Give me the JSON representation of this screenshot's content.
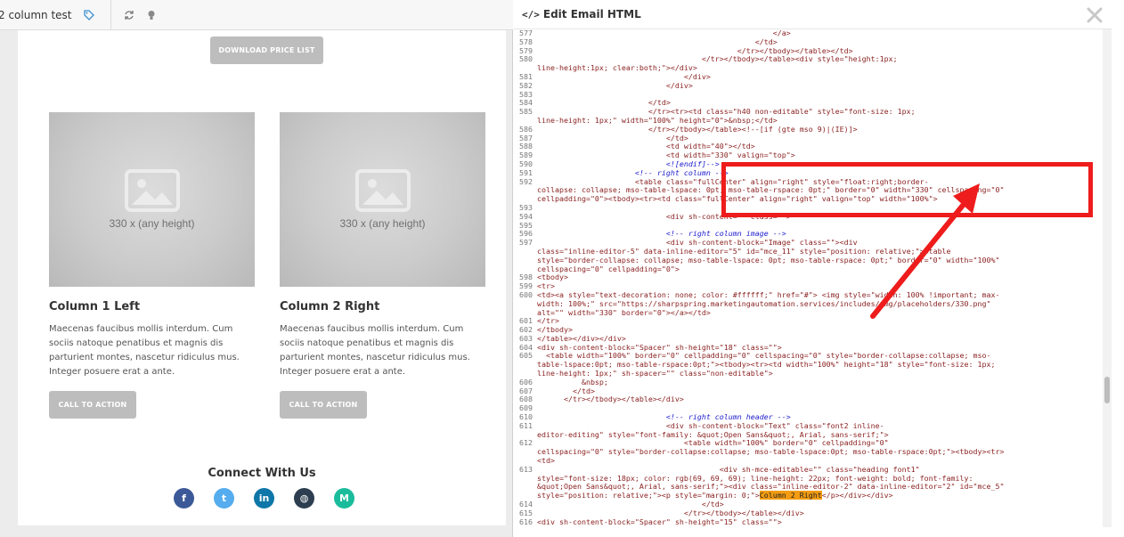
{
  "left_panel": {
    "title": "2 column test",
    "download_button": "DOWNLOAD PRICE LIST",
    "columns": [
      {
        "image_caption": "330 x (any height)",
        "heading": "Column 1 Left",
        "body": "Maecenas faucibus mollis interdum. Cum sociis natoque penatibus et magnis dis parturient montes, nascetur ridiculus mus. Integer posuere erat a ante.",
        "cta": "CALL TO ACTION"
      },
      {
        "image_caption": "330 x (any height)",
        "heading": "Column 2 Right",
        "body": "Maecenas faucibus mollis interdum. Cum sociis natoque penatibus et magnis dis parturient montes, nascetur ridiculus mus. Integer posuere erat a ante.",
        "cta": "CALL TO ACTION"
      }
    ],
    "connect_heading": "Connect With Us",
    "social_icons": [
      {
        "name": "facebook-icon",
        "glyph": "f",
        "color": "#3b5998"
      },
      {
        "name": "twitter-icon",
        "glyph": "t",
        "color": "#55acee"
      },
      {
        "name": "linkedin-icon",
        "glyph": "in",
        "color": "#0e76a8"
      },
      {
        "name": "globe-icon",
        "glyph": "◍",
        "color": "#2c3e50"
      },
      {
        "name": "m-icon",
        "glyph": "M",
        "color": "#1abc9c"
      }
    ]
  },
  "right_panel": {
    "title": "Edit Email HTML",
    "code_lines": [
      {
        "n": "577",
        "t": "                                                     </a>"
      },
      {
        "n": "578",
        "t": "                                                 </td>"
      },
      {
        "n": "579",
        "t": "                                             </tr></tbody></table></td>"
      },
      {
        "n": "580",
        "t": "                                     </tr></tbody></table><div style=\"height:1px;"
      },
      {
        "n": "",
        "t": "line-height:1px; clear:both;\"></div>"
      },
      {
        "n": "581",
        "t": "                                 </div>"
      },
      {
        "n": "582",
        "t": "                             </div>"
      },
      {
        "n": "583",
        "t": ""
      },
      {
        "n": "584",
        "t": "                         </td>"
      },
      {
        "n": "585",
        "t": "                         </tr><tr><td class=\"h40 non-editable\" style=\"font-size: 1px;"
      },
      {
        "n": "",
        "t": "line-height: 1px;\" width=\"100%\" height=\"0\">&nbsp;</td>"
      },
      {
        "n": "586",
        "t": "                         </tr></tbody></table><!--[if (gte mso 9)|(IE)]>"
      },
      {
        "n": "587",
        "t": "                             </td>"
      },
      {
        "n": "588",
        "t": "                             <td width=\"40\"></td>"
      },
      {
        "n": "589",
        "t": "                             <td width=\"330\" valign=\"top\">"
      },
      {
        "n": "590",
        "t": "                             <![endif]-->"
      },
      {
        "n": "591",
        "t": "                      <!-- right column -->"
      },
      {
        "n": "592",
        "t": "                      <table class=\"fullCenter\" align=\"right\" style=\"float:right;border-"
      },
      {
        "n": "",
        "t": "collapse: collapse; mso-table-lspace: 0pt; mso-table-rspace: 0pt;\" border=\"0\" width=\"330\" cellspacing=\"0\""
      },
      {
        "n": "",
        "t": "cellpadding=\"0\"><tbody><tr><td class=\"fullCenter\" align=\"right\" valign=\"top\" width=\"100%\">"
      },
      {
        "n": "593",
        "t": ""
      },
      {
        "n": "594",
        "t": "                             <div sh-content=\"\" class=\"\">"
      },
      {
        "n": "595",
        "t": ""
      },
      {
        "n": "596",
        "t": "                             <!-- right column image -->"
      },
      {
        "n": "597",
        "t": "                             <div sh-content-block=\"Image\" class=\"\"><div"
      },
      {
        "n": "",
        "t": "class=\"inline-editor-5\" data-inline-editor=\"5\" id=\"mce_11\" style=\"position: relative;\"><table"
      },
      {
        "n": "",
        "t": "style=\"border-collapse: collapse; mso-table-lspace: 0pt; mso-table-rspace: 0pt;\" border=\"0\" width=\"100%\""
      },
      {
        "n": "",
        "t": "cellspacing=\"0\" cellpadding=\"0\">"
      },
      {
        "n": "598",
        "t": "<tbody>"
      },
      {
        "n": "599",
        "t": "<tr>"
      },
      {
        "n": "600",
        "t": "<td><a style=\"text-decoration: none; color: #ffffff;\" href=\"#\"> <img style=\"width: 100% !important; max-"
      },
      {
        "n": "",
        "t": "width: 100%;\" src=\"https://sharpspring.marketingautomation.services/includes/img/placeholders/330.png\""
      },
      {
        "n": "",
        "t": "alt=\"\" width=\"330\" border=\"0\"></a></td>"
      },
      {
        "n": "601",
        "t": "</tr>"
      },
      {
        "n": "602",
        "t": "</tbody>"
      },
      {
        "n": "603",
        "t": "</table></div></div>"
      },
      {
        "n": "604",
        "t": "<div sh-content-block=\"Spacer\" sh-height=\"18\" class=\"\">"
      },
      {
        "n": "605",
        "t": "  <table width=\"100%\" border=\"0\" cellpadding=\"0\" cellspacing=\"0\" style=\"border-collapse:collapse; mso-"
      },
      {
        "n": "",
        "t": "table-lspace:0pt; mso-table-rspace:0pt;\"><tbody><tr><td width=\"100%\" height=\"18\" style=\"font-size: 1px;"
      },
      {
        "n": "",
        "t": "line-height: 1px;\" sh-spacer=\"\" class=\"non-editable\">"
      },
      {
        "n": "606",
        "t": "          &nbsp;"
      },
      {
        "n": "607",
        "t": "        </td>"
      },
      {
        "n": "608",
        "t": "      </tr></tbody></table></div>"
      },
      {
        "n": "609",
        "t": ""
      },
      {
        "n": "610",
        "t": "                             <!-- right column header -->"
      },
      {
        "n": "611",
        "t": "                             <div sh-content-block=\"Text\" class=\"font2 inline-"
      },
      {
        "n": "",
        "t": "editor-editing\" style=\"font-family: &quot;Open Sans&quot;, Arial, sans-serif;\">"
      },
      {
        "n": "612",
        "t": "                                 <table width=\"100%\" border=\"0\" cellpadding=\"0\""
      },
      {
        "n": "",
        "t": "cellspacing=\"0\" style=\"border-collapse:collapse; mso-table-lspace:0pt; mso-table-rspace:0pt;\"><tbody><tr>"
      },
      {
        "n": "",
        "t": "<td>"
      },
      {
        "n": "613",
        "t": "                                         <div sh-mce-editable=\"\" class=\"heading font1\""
      },
      {
        "n": "",
        "t": "style=\"font-size: 18px; color: rgb(69, 69, 69); line-height: 22px; font-weight: bold; font-family:"
      },
      {
        "n": "",
        "t": "&quot;Open Sans&quot;, Arial, sans-serif;\"><div class=\"inline-editor-2\" data-inline-editor=\"2\" id=\"mce_5\""
      },
      {
        "n": "",
        "t": "style=\"position: relative;\"><p style=\"margin: 0;\">",
        "hl": "Column 2 Right",
        "after": "</p></div></div>"
      },
      {
        "n": "614",
        "t": "                                     </td>"
      },
      {
        "n": "615",
        "t": "                                 </tr></tbody></table></div>"
      },
      {
        "n": "616",
        "t": "<div sh-content-block=\"Spacer\" sh-height=\"15\" class=\"\">"
      }
    ]
  }
}
